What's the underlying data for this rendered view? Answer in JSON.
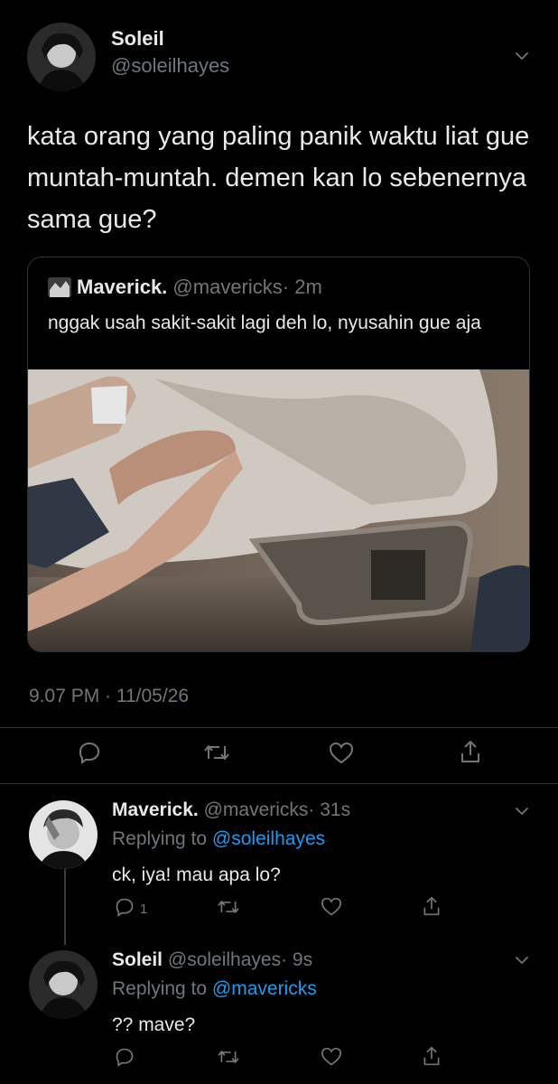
{
  "main_tweet": {
    "name": "Soleil",
    "handle": "@soleilhayes",
    "text": "kata orang yang paling panik waktu liat gue muntah-muntah. demen kan lo sebenernya sama gue?",
    "timestamp": "9.07 PM · 11/05/26",
    "quoted": {
      "name": "Maverick.",
      "handle": "@mavericks",
      "time": "· 2m",
      "text": "nggak usah sakit-sakit lagi deh lo, nyusahin gue aja"
    }
  },
  "replies": [
    {
      "name": "Maverick.",
      "handle": "@mavericks",
      "time": "· 31s",
      "replying_prefix": "Replying to",
      "replying_to": "@soleilhayes",
      "text": "ck, iya! mau apa lo?",
      "reply_count": "1"
    },
    {
      "name": "Soleil",
      "handle": "@soleilhayes",
      "time": "· 9s",
      "replying_prefix": "Replying to",
      "replying_to": "@mavericks",
      "text": "?? mave?",
      "reply_count": ""
    }
  ],
  "colors": {
    "background": "#000000",
    "text": "#e7e9ea",
    "muted": "#71767b",
    "link": "#1d9bf0",
    "divider": "#2f3336"
  },
  "icons": [
    "avatar-soleil",
    "avatar-maverick",
    "chevron-down-icon",
    "reply-icon",
    "retweet-icon",
    "like-icon",
    "share-icon"
  ]
}
